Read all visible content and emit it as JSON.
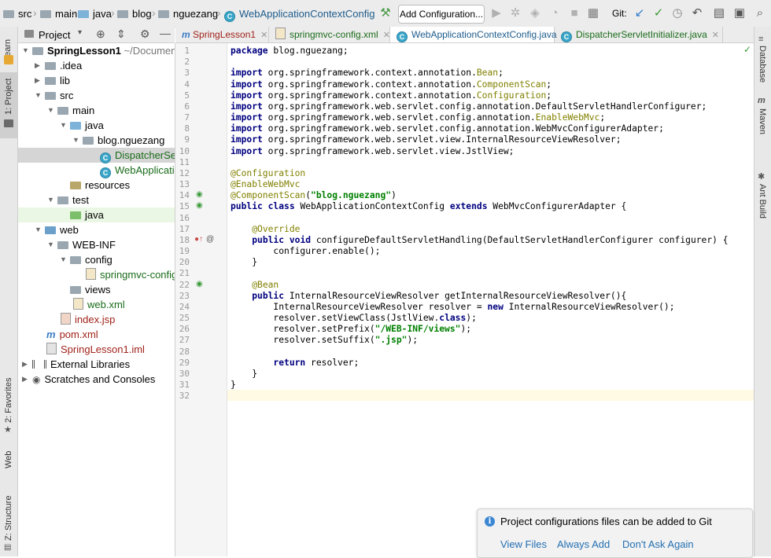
{
  "breadcrumbs": [
    "src",
    "main",
    "java",
    "blog",
    "nguezang",
    "WebApplicationContextConfig"
  ],
  "toolbar": {
    "add_configuration_label": "Add Configuration...",
    "git_label": "Git:"
  },
  "left_strip": {
    "learn": "Learn",
    "project": "1: Project",
    "favorites": "2: Favorites",
    "web": "Web",
    "structure": "Z: Structure"
  },
  "right_strip": {
    "database": "Database",
    "maven": "Maven",
    "ant_build": "Ant Build"
  },
  "project_panel": {
    "title": "Project"
  },
  "tree": {
    "root_name": "SpringLesson1",
    "root_path": "~/Documents",
    "items": [
      ".idea",
      "lib",
      "src",
      "main",
      "java",
      "blog.nguezang",
      "DispatcherServletInitializer",
      "WebApplicationContextConfig",
      "resources",
      "test",
      "java",
      "web",
      "WEB-INF",
      "config",
      "springmvc-config.xml",
      "views",
      "web.xml",
      "index.jsp",
      "pom.xml",
      "SpringLesson1.iml",
      "External Libraries",
      "Scratches and Consoles"
    ]
  },
  "tabs": [
    {
      "label": "SpringLesson1"
    },
    {
      "label": "springmvc-config.xml"
    },
    {
      "label": "WebApplicationContextConfig.java"
    },
    {
      "label": "DispatcherServletInitializer.java"
    }
  ],
  "code_lines": [
    "package blog.nguezang;",
    "",
    "import org.springframework.context.annotation.Bean;",
    "import org.springframework.context.annotation.ComponentScan;",
    "import org.springframework.context.annotation.Configuration;",
    "import org.springframework.web.servlet.config.annotation.DefaultServletHandlerConfigurer;",
    "import org.springframework.web.servlet.config.annotation.EnableWebMvc;",
    "import org.springframework.web.servlet.config.annotation.WebMvcConfigurerAdapter;",
    "import org.springframework.web.servlet.view.InternalResourceViewResolver;",
    "import org.springframework.web.servlet.view.JstlView;",
    "",
    "@Configuration",
    "@EnableWebMvc",
    "@ComponentScan(\"blog.nguezang\")",
    "public class WebApplicationContextConfig extends WebMvcConfigurerAdapter {",
    "",
    "    @Override",
    "    public void configureDefaultServletHandling(DefaultServletHandlerConfigurer configurer) {",
    "        configurer.enable();",
    "    }",
    "",
    "    @Bean",
    "    public InternalResourceViewResolver getInternalResourceViewResolver(){",
    "        InternalResourceViewResolver resolver = new InternalResourceViewResolver();",
    "        resolver.setViewClass(JstlView.class);",
    "        resolver.setPrefix(\"/WEB-INF/views\");",
    "        resolver.setSuffix(\".jsp\");",
    "",
    "        return resolver;",
    "    }",
    "}",
    ""
  ],
  "notification": {
    "message": "Project configurations files can be added to Git",
    "actions": [
      "View Files",
      "Always Add",
      "Don't Ask Again"
    ]
  },
  "colors": {
    "link": "#2470b3",
    "class_icon": "#3aa6c8",
    "keyword": "#000080",
    "annotation": "#808000",
    "string": "#008000",
    "selection": "#d5d5d5",
    "current_line": "#fffae3"
  }
}
